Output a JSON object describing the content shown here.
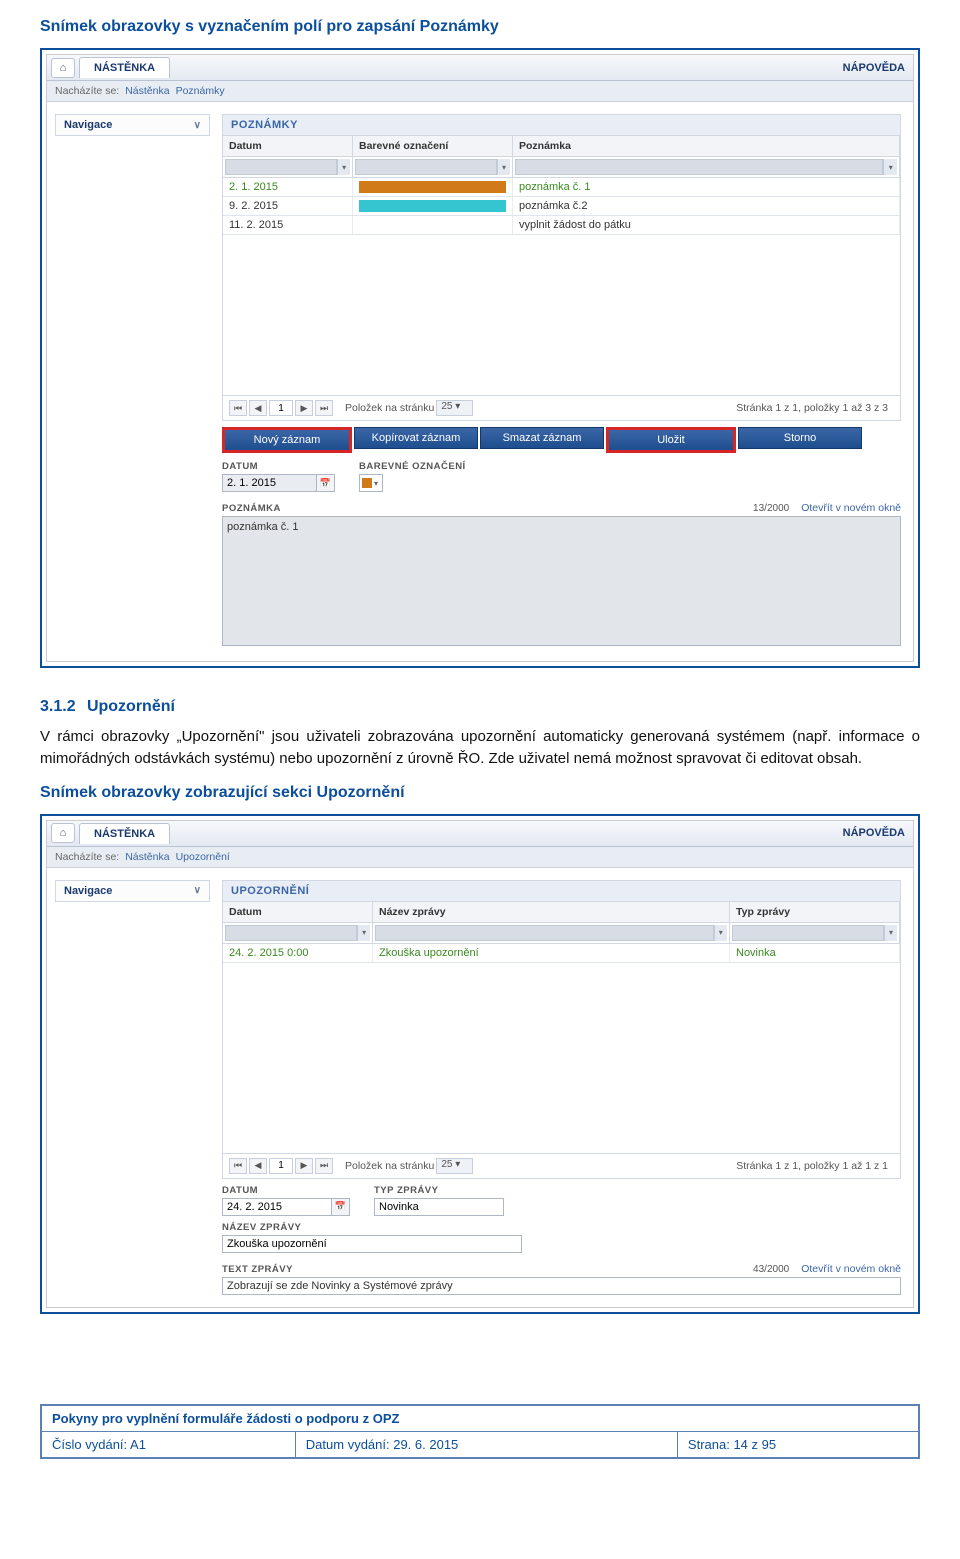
{
  "heading1": "Snímek obrazovky s vyznačením polí pro zapsání Poznámky",
  "section": {
    "num": "3.1.2",
    "title": "Upozornění"
  },
  "body_text": "V rámci obrazovky „Upozornění\" jsou uživateli zobrazována upozornění automaticky generovaná systémem (např. informace o mimořádných odstávkách systému) nebo upozornění z úrovně ŘO. Zde uživatel nemá možnost spravovat či editovat obsah.",
  "heading2": "Snímek obrazovky zobrazující sekci Upozornění",
  "app1": {
    "tab": "NÁSTĚNKA",
    "help": "NÁPOVĚDA",
    "breadcrumb": {
      "label": "Nacházíte se:",
      "items": [
        "Nástěnka",
        "Poznámky"
      ]
    },
    "nav": "Navigace",
    "panel_title": "POZNÁMKY",
    "cols": [
      "Datum",
      "Barevné označení",
      "Poznámka"
    ],
    "rows": [
      {
        "date": "2. 1. 2015",
        "color": "orange",
        "note": "poznámka č. 1",
        "cls": "green"
      },
      {
        "date": "9. 2. 2015",
        "color": "cyan",
        "note": "poznámka č.2",
        "cls": ""
      },
      {
        "date": "11. 2. 2015",
        "color": "",
        "note": "vyplnit žádost do pátku",
        "cls": ""
      }
    ],
    "pager": {
      "label": "Položek na stránku",
      "size": "25",
      "info": "Stránka 1 z 1, položky 1 až 3 z 3"
    },
    "buttons": {
      "new": "Nový záznam",
      "copy": "Kopírovat záznam",
      "delete": "Smazat záznam",
      "save": "Uložit",
      "cancel": "Storno"
    },
    "form": {
      "date_label": "DATUM",
      "date_value": "2. 1. 2015",
      "color_label": "BAREVNÉ OZNAČENÍ",
      "note_label": "POZNÁMKA",
      "note_value": "poznámka č. 1",
      "counter": "13/2000",
      "open_new": "Otevřít v novém okně"
    }
  },
  "app2": {
    "tab": "NÁSTĚNKA",
    "help": "NÁPOVĚDA",
    "breadcrumb": {
      "label": "Nacházíte se:",
      "items": [
        "Nástěnka",
        "Upozornění"
      ]
    },
    "nav": "Navigace",
    "panel_title": "UPOZORNĚNÍ",
    "cols": [
      "Datum",
      "Název zprávy",
      "Typ zprávy"
    ],
    "rows": [
      {
        "date": "24. 2. 2015 0:00",
        "name": "Zkouška upozornění",
        "type": "Novinka",
        "cls": "green"
      }
    ],
    "pager": {
      "label": "Položek na stránku",
      "size": "25",
      "info": "Stránka 1 z 1, položky 1 až 1 z 1"
    },
    "form": {
      "date_label": "DATUM",
      "date_value": "24. 2. 2015",
      "type_label": "TYP ZPRÁVY",
      "type_value": "Novinka",
      "name_label": "NÁZEV ZPRÁVY",
      "name_value": "Zkouška upozornění",
      "text_label": "TEXT ZPRÁVY",
      "text_value": "Zobrazují se zde Novinky a Systémové zprávy",
      "counter": "43/2000",
      "open_new": "Otevřít v novém okně"
    }
  },
  "footer": {
    "title": "Pokyny pro vyplnění formuláře žádosti o podporu z OPZ",
    "issue": "Číslo vydání: A1",
    "date": "Datum vydání: 29. 6. 2015",
    "page": "Strana: 14 z 95"
  }
}
